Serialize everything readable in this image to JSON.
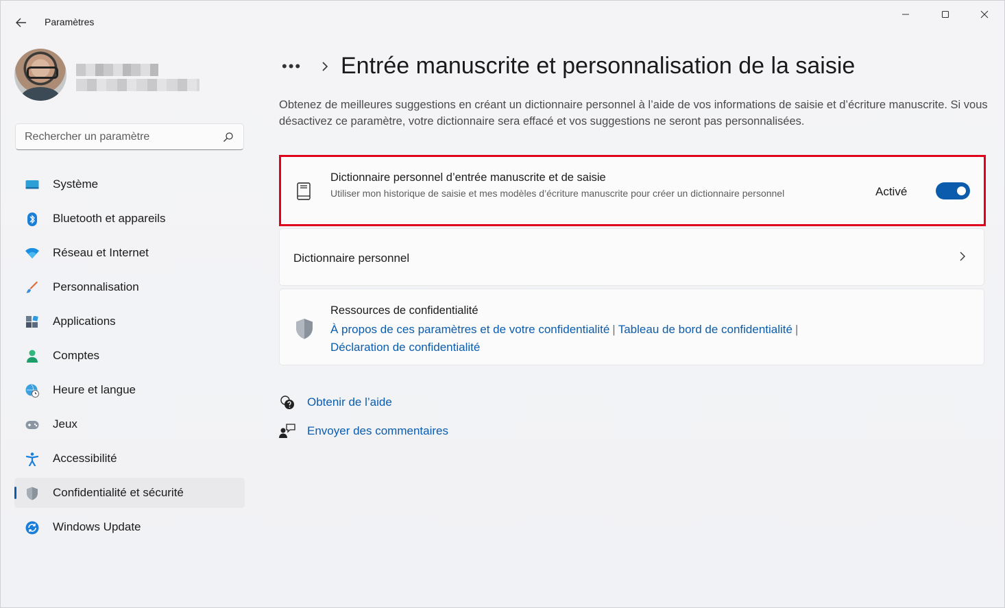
{
  "window": {
    "title": "Paramètres"
  },
  "search": {
    "placeholder": "Rechercher un paramètre"
  },
  "sidebar": {
    "items": [
      {
        "label": "Système",
        "icon": "monitor-icon"
      },
      {
        "label": "Bluetooth et appareils",
        "icon": "bluetooth-icon"
      },
      {
        "label": "Réseau et Internet",
        "icon": "wifi-icon"
      },
      {
        "label": "Personnalisation",
        "icon": "brush-icon"
      },
      {
        "label": "Applications",
        "icon": "apps-icon"
      },
      {
        "label": "Comptes",
        "icon": "person-icon"
      },
      {
        "label": "Heure et langue",
        "icon": "globe-clock-icon"
      },
      {
        "label": "Jeux",
        "icon": "gamepad-icon"
      },
      {
        "label": "Accessibilité",
        "icon": "accessibility-icon"
      },
      {
        "label": "Confidentialité et sécurité",
        "icon": "shield-icon",
        "active": true
      },
      {
        "label": "Windows Update",
        "icon": "update-icon"
      }
    ]
  },
  "main": {
    "breadcrumb_more": "•••",
    "title": "Entrée manuscrite et personnalisation de la saisie",
    "description": "Obtenez de meilleures suggestions en créant un dictionnaire personnel à l’aide de vos informations de saisie et d’écriture manuscrite. Si vous désactivez ce paramètre, votre dictionnaire sera effacé et vos suggestions ne seront pas personnalisées.",
    "toggle_card": {
      "title": "Dictionnaire personnel d’entrée manuscrite et de saisie",
      "subtitle": "Utiliser mon historique de saisie et mes modèles d’écriture manuscrite pour créer un dictionnaire personnel",
      "state_label": "Activé",
      "enabled": true
    },
    "dictionary_card": {
      "label": "Dictionnaire personnel"
    },
    "privacy_card": {
      "title": "Ressources de confidentialité",
      "link1": "À propos de ces paramètres et de votre confidentialité",
      "link2": "Tableau de bord de confidentialité",
      "link3": "Déclaration de confidentialité",
      "separator": "|"
    },
    "help": {
      "get_help": "Obtenir de l’aide",
      "feedback": "Envoyer des commentaires"
    }
  },
  "colors": {
    "accent": "#0b5cad",
    "highlight": "#e0001b"
  }
}
